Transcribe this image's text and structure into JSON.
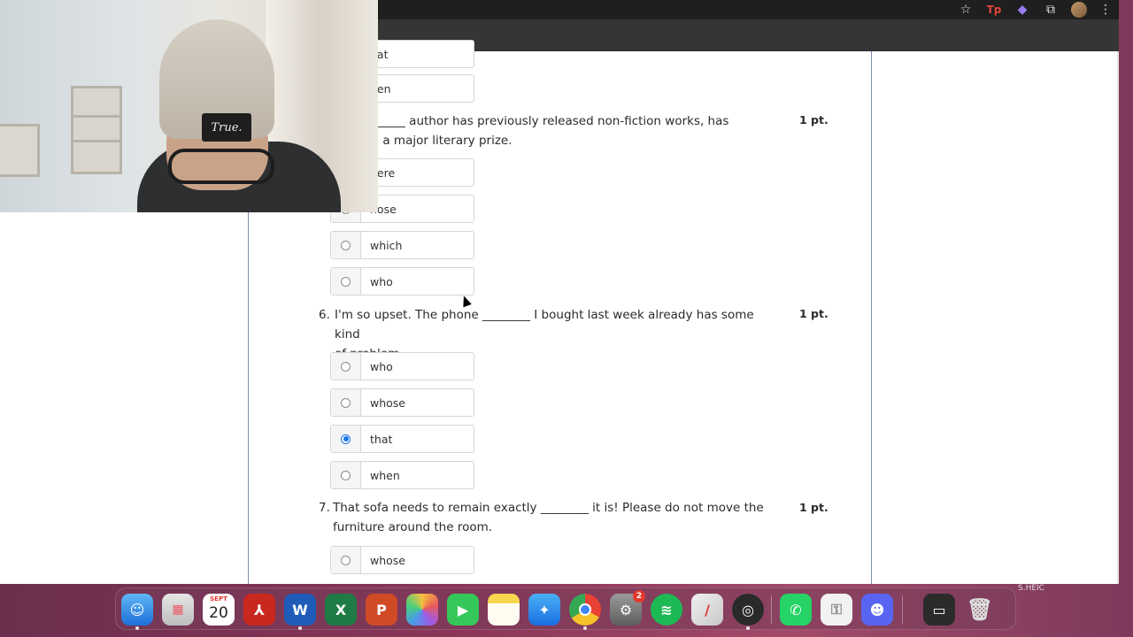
{
  "browser": {
    "icons": [
      "star-icon",
      "extension-red-icon",
      "extension-purple-icon",
      "puzzle-icon",
      "avatar",
      "kebab-menu-icon"
    ]
  },
  "quiz": {
    "partial_options_top": [
      {
        "label": "hat",
        "checked": false
      },
      {
        "label": "hen",
        "checked": false
      }
    ],
    "q5": {
      "text_line1": "rel, ________ author has previously released non-fiction works, has",
      "text_line2": "warded a major literary prize.",
      "points": "1 pt.",
      "options": [
        {
          "label": "here",
          "checked": false
        },
        {
          "label": "hose",
          "checked": false
        },
        {
          "label": "which",
          "checked": false
        },
        {
          "label": "who",
          "checked": false
        }
      ]
    },
    "q6": {
      "number": "6.",
      "text_line1": "I'm so upset. The phone ________ I bought last week already has some kind",
      "text_line2": "of problem.",
      "points": "1 pt.",
      "options": [
        {
          "label": "who",
          "checked": false
        },
        {
          "label": "whose",
          "checked": false
        },
        {
          "label": "that",
          "checked": true
        },
        {
          "label": "when",
          "checked": false
        }
      ]
    },
    "q7": {
      "number": "7.",
      "text_line1": "That sofa needs to remain exactly ________ it is! Please do not move the",
      "text_line2": "furniture around the room.",
      "points": "1 pt.",
      "options": [
        {
          "label": "whose",
          "checked": false
        }
      ]
    }
  },
  "webcam": {
    "beanie_patch": "True."
  },
  "dock": {
    "calendar_month": "SEPT",
    "calendar_day": "20",
    "settings_badge": "2",
    "apps": [
      "finder",
      "launchpad",
      "calendar",
      "acrobat",
      "word",
      "excel",
      "powerpoint",
      "photos",
      "facetime",
      "notes",
      "safari",
      "chrome",
      "system-settings",
      "spotify",
      "pencil-app",
      "obs",
      "whatsapp",
      "keychain",
      "discord",
      "screen-capture",
      "trash"
    ],
    "file_label": "S.HEIC"
  },
  "colors": {
    "accent_radio": "#1a73e8",
    "frame_border": "#7f8fb0"
  }
}
